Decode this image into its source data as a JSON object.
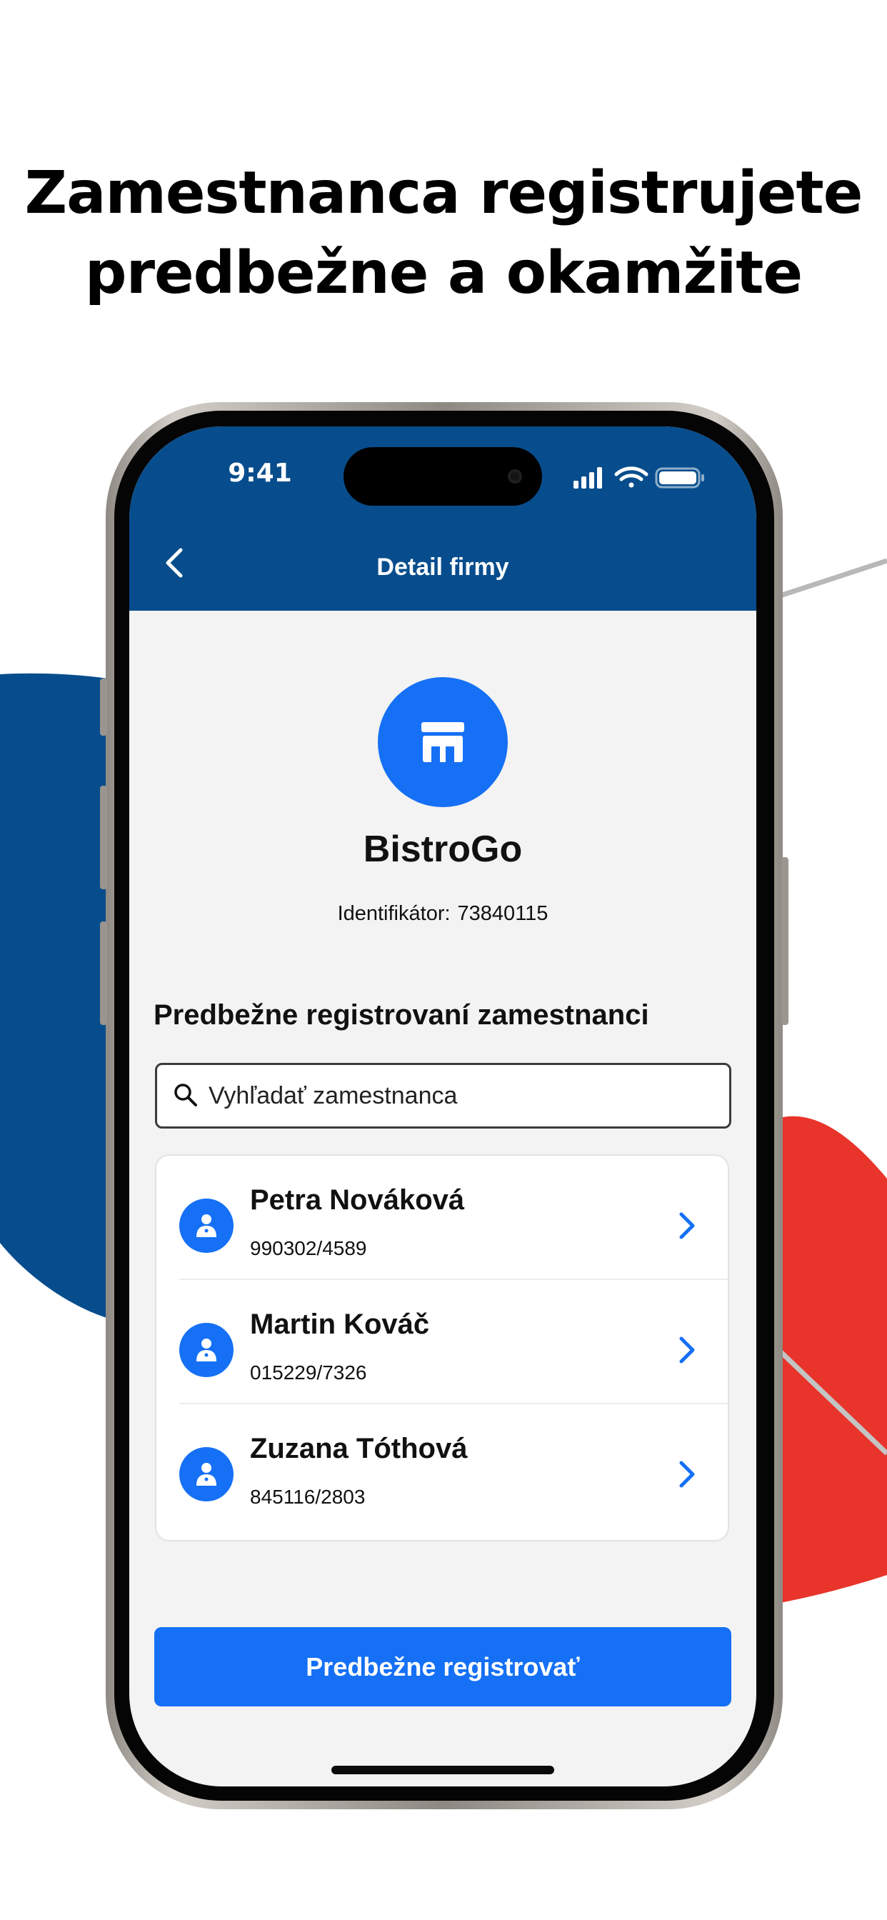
{
  "headline": {
    "line1": "Zamestnanca registrujete",
    "line2": "predbežne a okamžite"
  },
  "status_bar": {
    "time": "9:41",
    "icons": [
      "signal-icon",
      "wifi-icon",
      "battery-icon"
    ]
  },
  "nav": {
    "title": "Detail firmy",
    "back_icon": "chevron-left-icon"
  },
  "company": {
    "icon": "store-icon",
    "name": "BistroGo",
    "id_label": "Identifikátor:",
    "id_value": "73840115"
  },
  "employees_section": {
    "title": "Predbežne registrovaní zamestnanci",
    "search_placeholder": "Vyhľadať zamestnanca",
    "search_icon": "search-icon",
    "items": [
      {
        "name": "Petra Nováková",
        "birth_number": "990302/4589"
      },
      {
        "name": "Martin Kováč",
        "birth_number": "015229/7326"
      },
      {
        "name": "Zuzana Tóthová",
        "birth_number": "845116/2803"
      }
    ]
  },
  "primary_action": {
    "label": "Predbežne registrovať"
  },
  "colors": {
    "header_blue": "#074d8d",
    "accent_blue": "#1570f5",
    "decor_red": "#e8342a",
    "screen_bg": "#f3f3f3"
  }
}
